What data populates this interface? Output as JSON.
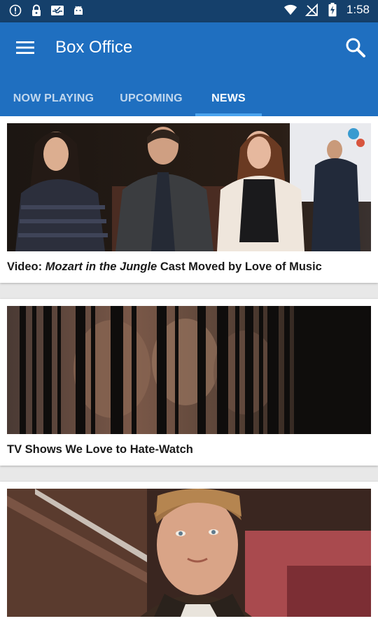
{
  "status_bar": {
    "time": "1:58",
    "icons": [
      "alert-icon",
      "lock-icon",
      "inbox-icon",
      "android-icon",
      "wifi-icon",
      "no-signal-icon",
      "battery-charging-icon"
    ]
  },
  "app_bar": {
    "title": "Box Office",
    "menu_icon": "hamburger-menu-icon",
    "search_icon": "search-icon",
    "color": "#1f6fc0"
  },
  "tabs": [
    {
      "label": "NOW PLAYING",
      "active": false
    },
    {
      "label": "UPCOMING",
      "active": false
    },
    {
      "label": "NEWS",
      "active": true
    }
  ],
  "news": [
    {
      "title_prefix": "Video: ",
      "title_italic": "Mozart in the Jungle",
      "title_suffix": " Cast Moved by Love of Music",
      "image": "three people seated at press junket in front of a poster"
    },
    {
      "title_prefix": "TV Shows We Love to Hate-Watch",
      "title_italic": "",
      "title_suffix": "",
      "image": "blurred collage of faces with dark vertical bars"
    },
    {
      "title_prefix": "",
      "title_italic": "",
      "title_suffix": "",
      "image": "man in brown jacket looking upward"
    }
  ]
}
